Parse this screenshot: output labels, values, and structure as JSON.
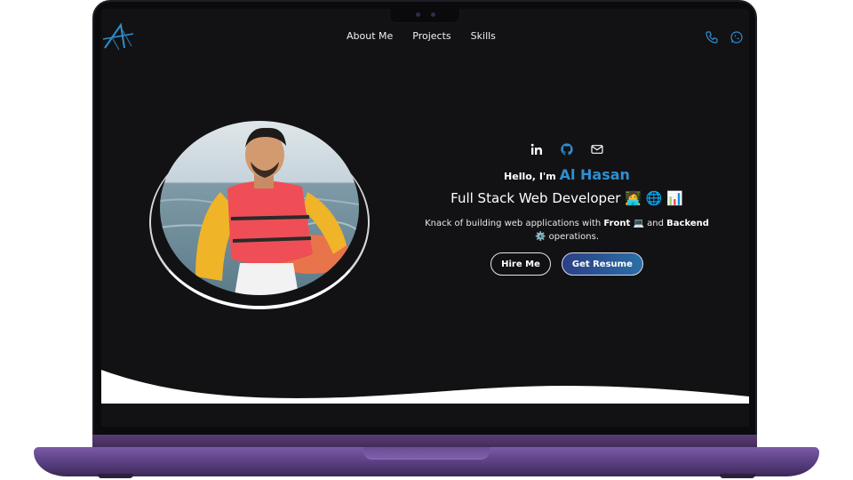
{
  "nav": {
    "links": [
      "About Me",
      "Projects",
      "Skills"
    ],
    "right_icons": [
      "phone-icon",
      "whatsapp-icon"
    ],
    "logo": "monogram-a-logo"
  },
  "hero": {
    "social_icons": [
      "linkedin-icon",
      "github-icon",
      "mail-icon"
    ],
    "greeting": "Hello, I'm",
    "name": "Al Hasan",
    "role": "Full Stack Web Developer",
    "role_emojis": "🧑‍💻 🌐 📊",
    "desc_pre": "Knack of building web applications with",
    "desc_front": "Front",
    "desc_front_emoji": "💻",
    "desc_and": "and",
    "desc_back": "Backend",
    "desc_back_emoji": "⚙️",
    "desc_post": "operations.",
    "buttons": {
      "hire": "Hire Me",
      "resume": "Get Resume"
    }
  },
  "colors": {
    "accent": "#2f8fd0",
    "screen_bg": "#121214",
    "laptop_purple": "#5e4388"
  }
}
